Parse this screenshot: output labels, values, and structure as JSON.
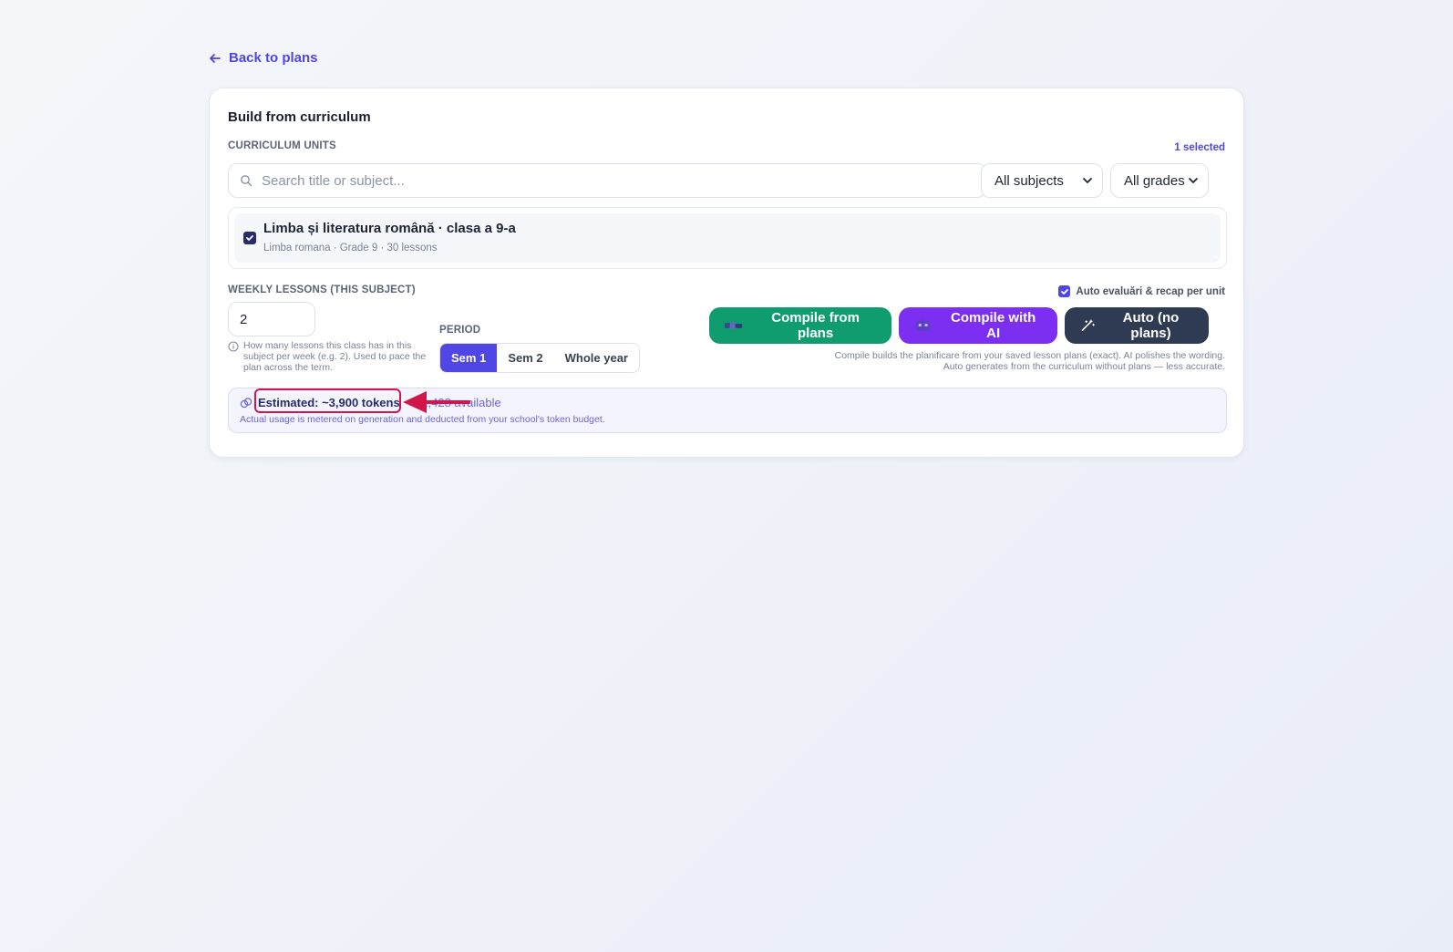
{
  "nav": {
    "back_label": "Back to plans"
  },
  "card": {
    "title": "Build from curriculum",
    "units_label": "CURRICULUM UNITS",
    "selected_count": "1 selected",
    "search": {
      "placeholder": "Search title or subject..."
    },
    "subject_filter": {
      "value": "All subjects"
    },
    "grade_filter": {
      "value": "All grades"
    },
    "units": [
      {
        "title": "Limba și literatura română · clasa a 9-a",
        "meta": "Limba romana · Grade 9 · 30 lessons",
        "checked": true
      }
    ]
  },
  "weekly": {
    "label": "WEEKLY LESSONS (THIS SUBJECT)",
    "value": "2",
    "hint": "How many lessons this class has in this subject per week (e.g. 2). Used to pace the plan across the term."
  },
  "period": {
    "label": "PERIOD",
    "options": [
      "Sem 1",
      "Sem 2",
      "Whole year"
    ],
    "selected": "Sem 1"
  },
  "actions": {
    "auto_check_label": "Auto evaluări & recap per unit",
    "auto_checked": true,
    "compile_plans": "Compile from plans",
    "compile_ai": "Compile with AI",
    "auto_no_plans": "Auto (no plans)",
    "note_line1": "Compile builds the planificare from your saved lesson plans (exact). AI polishes the wording.",
    "note_line2": "Auto generates from the curriculum without plans — less accurate."
  },
  "estimate": {
    "estimated": "Estimated: ~3,900 tokens",
    "separator": "·",
    "available": "91,428 available",
    "note": "Actual usage is metered on generation and deducted from your school's token budget."
  },
  "colors": {
    "accent": "#4f46e5",
    "green": "#0f9d6f",
    "purple": "#7c2ff0",
    "dark": "#2f3b52",
    "highlight": "#d1164b"
  }
}
